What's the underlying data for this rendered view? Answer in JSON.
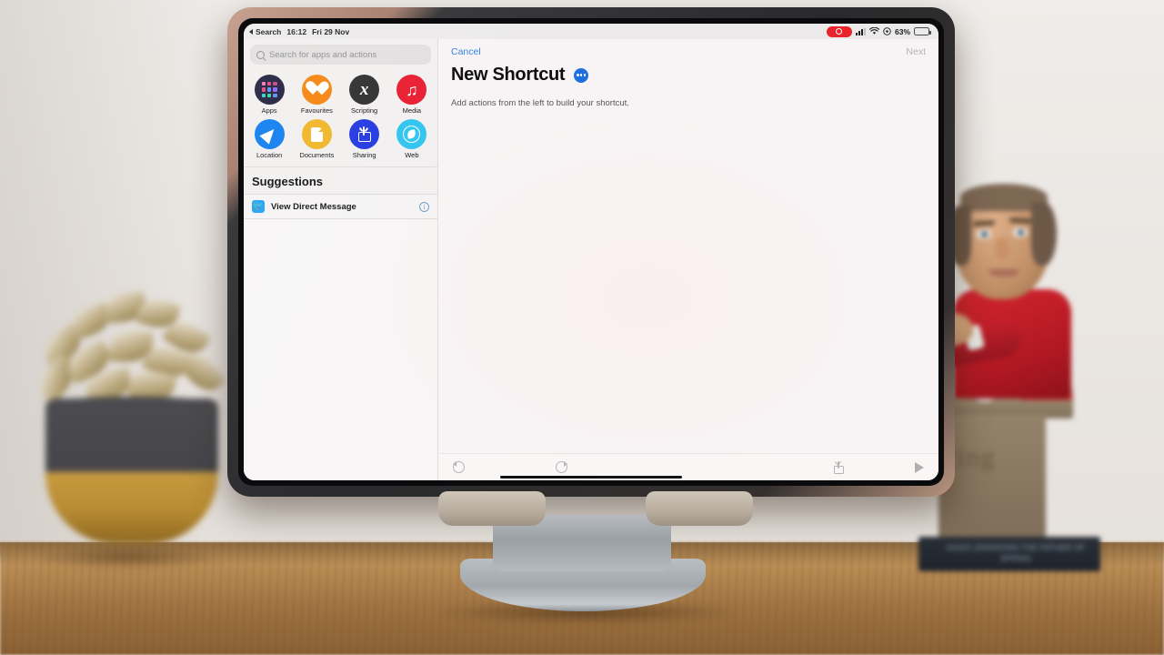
{
  "device": {
    "name": "ipad-pro",
    "orientation": "landscape"
  },
  "status_bar": {
    "back_label": "Search",
    "time": "16:12",
    "date": "Fri 29 Nov",
    "recording_indicator": "record-icon",
    "cellular": "cellular-bars-icon",
    "wifi": "wifi-icon",
    "rotation_lock": "rotation-lock-icon",
    "battery_percent": "63%",
    "battery_icon": "battery-icon",
    "battery_level": 63,
    "battery_color": "#35c759"
  },
  "sidebar": {
    "search": {
      "placeholder": "Search for apps and actions",
      "value": "",
      "icon": "search-icon"
    },
    "categories": [
      {
        "label": "Apps",
        "icon": "apps-grid-icon",
        "color": "#1c1b3a"
      },
      {
        "label": "Favourites",
        "icon": "heart-icon",
        "color": "#f5820b"
      },
      {
        "label": "Scripting",
        "icon": "x-variable-icon",
        "color": "#2b2b2b"
      },
      {
        "label": "Media",
        "icon": "music-note-icon",
        "color": "#e8192c"
      },
      {
        "label": "Location",
        "icon": "navigation-arrow-icon",
        "color": "#0a7bef"
      },
      {
        "label": "Documents",
        "icon": "document-icon",
        "color": "#f0b323"
      },
      {
        "label": "Sharing",
        "icon": "share-icon",
        "color": "#1f35e0"
      },
      {
        "label": "Web",
        "icon": "compass-icon",
        "color": "#2cc4f0"
      }
    ],
    "suggestions_header": "Suggestions",
    "suggestions": [
      {
        "label": "View Direct Message",
        "app_icon": "twitter-icon",
        "app_color": "#1da1f2",
        "info": "i"
      }
    ]
  },
  "main": {
    "cancel_label": "Cancel",
    "next_label": "Next",
    "title": "New Shortcut",
    "more_button": "more-options-icon",
    "subtitle": "Add actions from the left to build your shortcut.",
    "accent_color": "#2a7fe0"
  },
  "toolbar": {
    "undo": "undo-icon",
    "redo": "redo-icon",
    "share": "share-icon",
    "play": "play-icon"
  },
  "scene": {
    "bobblehead_podium_text": "ring",
    "bobblehead_base_text": "HUGO JOHNSONS THE FATHER OF SPRING"
  }
}
